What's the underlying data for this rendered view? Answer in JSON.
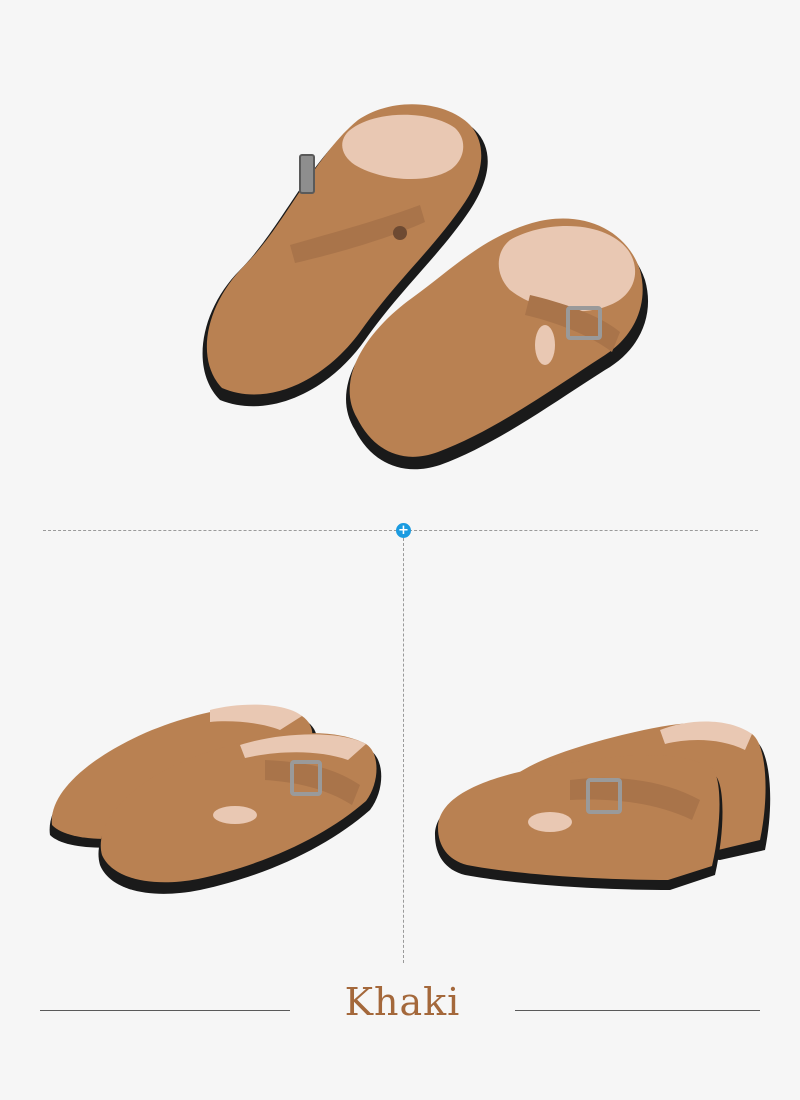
{
  "colors": {
    "background": "#f6f6f6",
    "shoe_leather": "#b98152",
    "shoe_dark": "#9c673c",
    "sole": "#1a1a1a",
    "lining": "#e9c8b3",
    "accent_plus": "#1b9be0",
    "label_text": "#a4683b"
  },
  "images": {
    "top": "pair-of-khaki-buckle-shoes-top-view",
    "bottom_left": "pair-of-khaki-buckle-shoes-front-left-view",
    "bottom_right": "pair-of-khaki-buckle-shoes-side-right-view"
  },
  "icons": {
    "plus": "+"
  },
  "label": {
    "color_name": "Khaki"
  }
}
